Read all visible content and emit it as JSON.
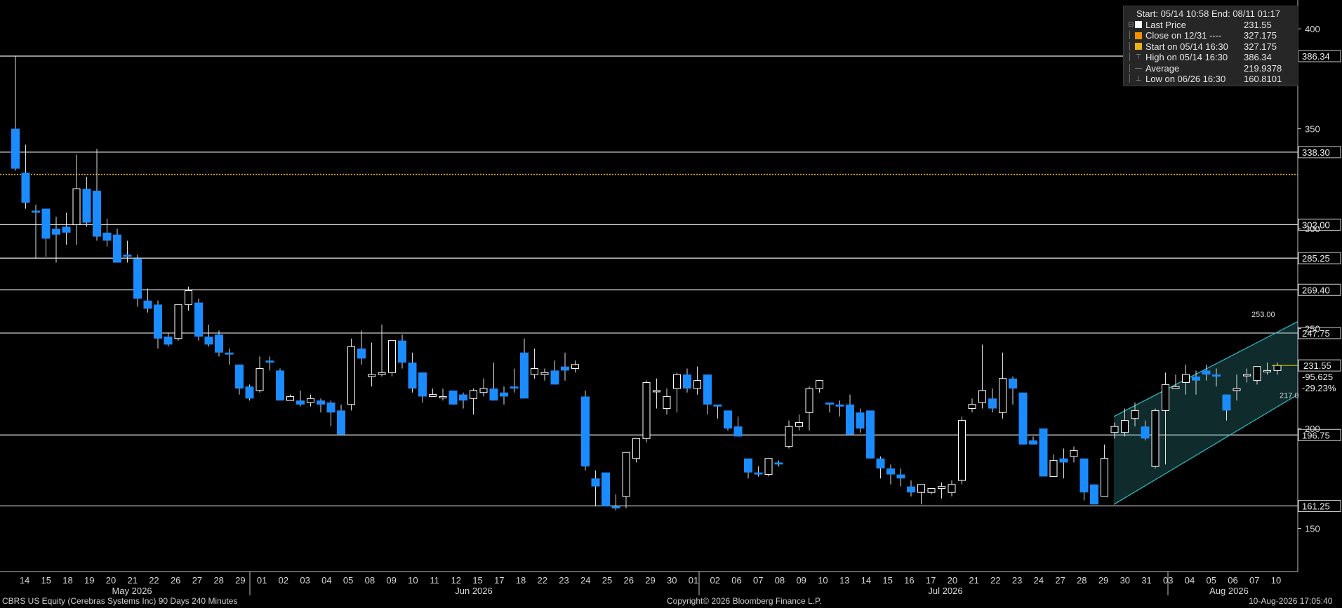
{
  "chart_data": {
    "type": "candlestick",
    "security": "CBRS US Equity (Cerebras Systems Inc) 90 Days 240 Minutes",
    "y_ticks": [
      150,
      200,
      250,
      300,
      350,
      400
    ],
    "ylim": [
      140,
      406
    ],
    "level_lines": [
      {
        "label": "386.34",
        "value": 386.34
      },
      {
        "label": "338.30",
        "value": 338.3
      },
      {
        "label": "302.00",
        "value": 302.0
      },
      {
        "label": "285.25",
        "value": 285.25
      },
      {
        "label": "269.40",
        "value": 269.4
      },
      {
        "label": "247.75",
        "value": 247.75
      },
      {
        "label": "196.75",
        "value": 196.75
      },
      {
        "label": "161.25",
        "value": 161.25
      }
    ],
    "last_price_tag": "231.55",
    "change_tag": "-95.625",
    "pct_tag": "-29.23%",
    "channel_top_label": "253.00",
    "channel_mid_label": "217.0",
    "close_on_line": 327.175,
    "x_day_labels": [
      "14",
      "15",
      "18",
      "19",
      "20",
      "21",
      "22",
      "26",
      "27",
      "28",
      "29",
      "01",
      "02",
      "03",
      "04",
      "05",
      "08",
      "09",
      "10",
      "11",
      "12",
      "15",
      "17",
      "18",
      "22",
      "23",
      "24",
      "25",
      "26",
      "29",
      "30",
      "01",
      "02",
      "06",
      "07",
      "08",
      "09",
      "10",
      "13",
      "14",
      "15",
      "16",
      "17",
      "20",
      "21",
      "22",
      "23",
      "24",
      "27",
      "28",
      "29",
      "30",
      "31",
      "03",
      "04",
      "05",
      "06",
      "07",
      "10"
    ],
    "month_labels": [
      "May 2026",
      "Jun 2026",
      "Jul 2026",
      "Aug 2026"
    ],
    "candles": [
      [
        350,
        330,
        386.34,
        329
      ],
      [
        328,
        313,
        342,
        310
      ],
      [
        309,
        308,
        312,
        285
      ],
      [
        310,
        295,
        310,
        286
      ],
      [
        300,
        297,
        306,
        283
      ],
      [
        301,
        298,
        308,
        292
      ],
      [
        302,
        320,
        337,
        292
      ],
      [
        320,
        303,
        326,
        301
      ],
      [
        319,
        296,
        340,
        294
      ],
      [
        298,
        294,
        305,
        291
      ],
      [
        297,
        283,
        300,
        284
      ],
      [
        287,
        286,
        294,
        283
      ],
      [
        285,
        265,
        287,
        261
      ],
      [
        264,
        260,
        270,
        258
      ],
      [
        262,
        245,
        264,
        240
      ],
      [
        246,
        242,
        248,
        241
      ],
      [
        245,
        262,
        262,
        244
      ],
      [
        262,
        269,
        271,
        259
      ],
      [
        263,
        246,
        265,
        244
      ],
      [
        246,
        242,
        252,
        241
      ],
      [
        247,
        238,
        249,
        236
      ],
      [
        238,
        237,
        240,
        232
      ],
      [
        232,
        220,
        232,
        217
      ],
      [
        221,
        215,
        222,
        214
      ],
      [
        219,
        230,
        236,
        218
      ],
      [
        234,
        233,
        236,
        229
      ],
      [
        229,
        214,
        230,
        214
      ],
      [
        214,
        216,
        217,
        214
      ],
      [
        214,
        212,
        219,
        211
      ],
      [
        213,
        215,
        217,
        211
      ],
      [
        214,
        212,
        215,
        208
      ],
      [
        213,
        208,
        214,
        201
      ],
      [
        209,
        197,
        212,
        197
      ],
      [
        212,
        241,
        245,
        209
      ],
      [
        240,
        235,
        249,
        232
      ],
      [
        226,
        227,
        243,
        221
      ],
      [
        227,
        228,
        252,
        226
      ],
      [
        228,
        244,
        244,
        226
      ],
      [
        244,
        233,
        247,
        230
      ],
      [
        233,
        220,
        238,
        218
      ],
      [
        228,
        216,
        228,
        213
      ],
      [
        216,
        217,
        220,
        216
      ],
      [
        216,
        216,
        220,
        214
      ],
      [
        219,
        212,
        219,
        213
      ],
      [
        217,
        214,
        218,
        210
      ],
      [
        215,
        219,
        220,
        207
      ],
      [
        218,
        220,
        225,
        216
      ],
      [
        220,
        214,
        233,
        214
      ],
      [
        218,
        216,
        221,
        212
      ],
      [
        221,
        220,
        230,
        218
      ],
      [
        238,
        215,
        245,
        215
      ],
      [
        227,
        230,
        240,
        225
      ],
      [
        227,
        228,
        230,
        224
      ],
      [
        229,
        222,
        234,
        223
      ],
      [
        231,
        229,
        238,
        224
      ],
      [
        230,
        232,
        234,
        228
      ],
      [
        216,
        181,
        219,
        179
      ],
      [
        175,
        171,
        179,
        161
      ],
      [
        178,
        161,
        178,
        164
      ],
      [
        161,
        160,
        167,
        159
      ],
      [
        166,
        188,
        188,
        160
      ],
      [
        185,
        195,
        192,
        183
      ],
      [
        195,
        223,
        224,
        193
      ],
      [
        219,
        219,
        225,
        210
      ],
      [
        210,
        216,
        220,
        207
      ],
      [
        220,
        227,
        228,
        208
      ],
      [
        227,
        220,
        230,
        218
      ],
      [
        220,
        224,
        231,
        217
      ],
      [
        227,
        212,
        226,
        207
      ],
      [
        212,
        211,
        212,
        205
      ],
      [
        209,
        200,
        209,
        199
      ],
      [
        201,
        196,
        206,
        196
      ],
      [
        185,
        178,
        184,
        175
      ],
      [
        178,
        177,
        181,
        176
      ],
      [
        177,
        185,
        183,
        176
      ],
      [
        183,
        182,
        184,
        181
      ],
      [
        191,
        201,
        204,
        190
      ],
      [
        201,
        203,
        207,
        199
      ],
      [
        208,
        220,
        221,
        199
      ],
      [
        220,
        224,
        224,
        218
      ],
      [
        213,
        212,
        213,
        208
      ],
      [
        212,
        211,
        214,
        206
      ],
      [
        212,
        197,
        217,
        201
      ],
      [
        208,
        200,
        210,
        198
      ],
      [
        209,
        185,
        209,
        186
      ],
      [
        185,
        180,
        186,
        175
      ],
      [
        180,
        177,
        182,
        172
      ],
      [
        177,
        175,
        180,
        171
      ],
      [
        171,
        168,
        174,
        166
      ],
      [
        168,
        172,
        172,
        162
      ],
      [
        168,
        170,
        170,
        167
      ],
      [
        170,
        171,
        173,
        165
      ],
      [
        168,
        172,
        174,
        166
      ],
      [
        174,
        204,
        206,
        172
      ],
      [
        210,
        212,
        215,
        208
      ],
      [
        213,
        219,
        242,
        210
      ],
      [
        215,
        210,
        220,
        208
      ],
      [
        208,
        225,
        238,
        205
      ],
      [
        225,
        220,
        226,
        212
      ],
      [
        218,
        192,
        215,
        195
      ],
      [
        194,
        192,
        196,
        193
      ],
      [
        200,
        176,
        200,
        176
      ],
      [
        176,
        184,
        187,
        176
      ],
      [
        185,
        183,
        190,
        175
      ],
      [
        186,
        189,
        191,
        183
      ],
      [
        185,
        168,
        185,
        164
      ],
      [
        172,
        162,
        172,
        162
      ],
      [
        166,
        185,
        192,
        166
      ],
      [
        198,
        201,
        203,
        195
      ],
      [
        198,
        204,
        210,
        196
      ],
      [
        205,
        209,
        213,
        201
      ],
      [
        201,
        195,
        204,
        194
      ],
      [
        181,
        209,
        210,
        180
      ],
      [
        209,
        222,
        228,
        182
      ],
      [
        220,
        221,
        227,
        220
      ],
      [
        223,
        227,
        232,
        217
      ],
      [
        226,
        224,
        229,
        217
      ],
      [
        229,
        227,
        232,
        224
      ],
      [
        227,
        226,
        230,
        221
      ],
      [
        217,
        209,
        217,
        204
      ],
      [
        219,
        220,
        227,
        214
      ],
      [
        227,
        227,
        230,
        223
      ],
      [
        224,
        231,
        229,
        222
      ],
      [
        229,
        229,
        233,
        227
      ],
      [
        229,
        231.55,
        233,
        227
      ]
    ]
  },
  "legend": {
    "header": "Start: 05/14 10:58 End: 08/11 01:17",
    "rows": [
      {
        "label": "Last Price",
        "value": "231.55",
        "swatch": "#ffffff"
      },
      {
        "label": "Close on 12/31 ----",
        "value": "327.175",
        "swatch": "#f39200"
      },
      {
        "label": "Start on 05/14 16:30",
        "value": "327.175",
        "swatch": "#e8b21a"
      },
      {
        "label": "High on 05/14 16:30",
        "value": "386.34",
        "swatch": ""
      },
      {
        "label": "Average",
        "value": "219.9378",
        "swatch": ""
      },
      {
        "label": "Low on 06/26 16:30",
        "value": "160.8101",
        "swatch": ""
      }
    ]
  },
  "footer": {
    "left": "CBRS US Equity (Cerebras Systems Inc) 90 Days 240 Minutes",
    "center": "Copyright© 2026 Bloomberg Finance L.P.",
    "right": "10-Aug-2026 17:05:40"
  },
  "colors": {
    "up": "#ffffff",
    "down": "#1a8cff",
    "channel": "#27c1c9",
    "close_line": "#f2c200"
  }
}
